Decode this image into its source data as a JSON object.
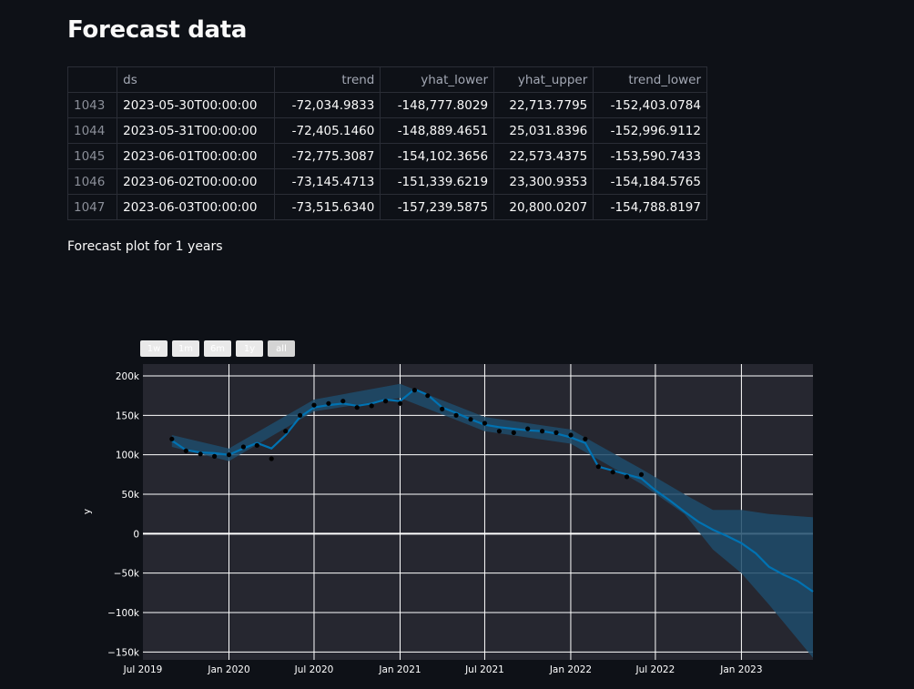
{
  "page": {
    "title": "Forecast data",
    "caption": "Forecast plot for 1 years"
  },
  "table": {
    "columns": [
      "",
      "ds",
      "trend",
      "yhat_lower",
      "yhat_upper",
      "trend_lower"
    ],
    "rows": [
      [
        "1043",
        "2023-05-30T00:00:00",
        "-72,034.9833",
        "-148,777.8029",
        "22,713.7795",
        "-152,403.0784"
      ],
      [
        "1044",
        "2023-05-31T00:00:00",
        "-72,405.1460",
        "-148,889.4651",
        "25,031.8396",
        "-152,996.9112"
      ],
      [
        "1045",
        "2023-06-01T00:00:00",
        "-72,775.3087",
        "-154,102.3656",
        "22,573.4375",
        "-153,590.7433"
      ],
      [
        "1046",
        "2023-06-02T00:00:00",
        "-73,145.4713",
        "-151,339.6219",
        "23,300.9353",
        "-154,184.5765"
      ],
      [
        "1047",
        "2023-06-03T00:00:00",
        "-73,515.6340",
        "-157,239.5875",
        "20,800.0207",
        "-154,788.8197"
      ]
    ]
  },
  "range_selector": [
    {
      "label": "1w",
      "active": false
    },
    {
      "label": "1m",
      "active": false
    },
    {
      "label": "6m",
      "active": false
    },
    {
      "label": "1y",
      "active": false
    },
    {
      "label": "all",
      "active": true
    }
  ],
  "colors": {
    "background": "#0e1117",
    "plot_bg": "#262730",
    "forecast_line": "#0072b2",
    "uncertainty_band": "#1f4c6b",
    "actual_points": "#000000",
    "grid": "#ffffff"
  },
  "chart_data": {
    "type": "line",
    "title": "",
    "xlabel": "",
    "ylabel": "y",
    "x_ticks": [
      "Jul 2019",
      "Jan 2020",
      "Jul 2020",
      "Jan 2021",
      "Jul 2021",
      "Jan 2022",
      "Jul 2022",
      "Jan 2023"
    ],
    "y_ticks": [
      "−150k",
      "−100k",
      "−50k",
      "0",
      "50k",
      "100k",
      "150k",
      "200k"
    ],
    "xlim": [
      "2019-07-01",
      "2023-06-03"
    ],
    "ylim": [
      -160000,
      215000
    ],
    "grid": true,
    "legend": "none",
    "series": [
      {
        "kind": "actual",
        "x": [
          "2019-09-01",
          "2019-10-01",
          "2019-11-01",
          "2019-12-01",
          "2020-01-01",
          "2020-02-01",
          "2020-03-01",
          "2020-04-01",
          "2020-05-01",
          "2020-06-01",
          "2020-07-01",
          "2020-08-01",
          "2020-09-01",
          "2020-10-01",
          "2020-11-01",
          "2020-12-01",
          "2021-01-01",
          "2021-02-01",
          "2021-03-01",
          "2021-04-01",
          "2021-05-01",
          "2021-06-01",
          "2021-07-01",
          "2021-08-01",
          "2021-09-01",
          "2021-10-01",
          "2021-11-01",
          "2021-12-01",
          "2022-01-01",
          "2022-02-01",
          "2022-03-01",
          "2022-04-01",
          "2022-05-01",
          "2022-06-01"
        ],
        "y": [
          120000,
          105000,
          101000,
          98000,
          100000,
          110000,
          112000,
          95000,
          130000,
          150000,
          163000,
          165000,
          168000,
          160000,
          162000,
          168000,
          165000,
          182000,
          175000,
          158000,
          150000,
          145000,
          140000,
          130000,
          128000,
          133000,
          130000,
          128000,
          125000,
          120000,
          85000,
          78000,
          72000,
          75000
        ]
      },
      {
        "kind": "forecast",
        "x": [
          "2019-09-01",
          "2019-10-01",
          "2019-11-01",
          "2019-12-01",
          "2020-01-01",
          "2020-02-01",
          "2020-03-01",
          "2020-04-01",
          "2020-05-01",
          "2020-06-01",
          "2020-07-01",
          "2020-08-01",
          "2020-09-01",
          "2020-10-01",
          "2020-11-01",
          "2020-12-01",
          "2021-01-01",
          "2021-02-01",
          "2021-03-01",
          "2021-04-01",
          "2021-05-01",
          "2021-06-01",
          "2021-07-01",
          "2021-08-01",
          "2021-09-01",
          "2021-10-01",
          "2021-11-01",
          "2021-12-01",
          "2022-01-01",
          "2022-02-01",
          "2022-03-01",
          "2022-04-01",
          "2022-05-01",
          "2022-06-01",
          "2022-07-01",
          "2022-08-01",
          "2022-09-01",
          "2022-10-01",
          "2022-11-01",
          "2022-12-01",
          "2023-01-01",
          "2023-02-01",
          "2023-03-01",
          "2023-04-01",
          "2023-05-01",
          "2023-06-03"
        ],
        "y": [
          118000,
          106000,
          103000,
          102000,
          100000,
          108000,
          115000,
          108000,
          125000,
          148000,
          160000,
          163000,
          165000,
          162000,
          165000,
          170000,
          168000,
          183000,
          176000,
          160000,
          153000,
          145000,
          138000,
          135000,
          133000,
          131000,
          130000,
          127000,
          122000,
          115000,
          85000,
          80000,
          75000,
          70000,
          55000,
          42000,
          28000,
          15000,
          5000,
          -3000,
          -12000,
          -25000,
          -42000,
          -52000,
          -60000,
          -73516
        ]
      },
      {
        "kind": "upper",
        "x": [
          "2019-09-01",
          "2020-01-01",
          "2020-07-01",
          "2021-01-01",
          "2021-07-01",
          "2022-01-01",
          "2022-06-01",
          "2022-09-01",
          "2022-11-01",
          "2023-01-01",
          "2023-03-01",
          "2023-06-03"
        ],
        "y": [
          125000,
          108000,
          170000,
          190000,
          148000,
          132000,
          82000,
          50000,
          30000,
          30000,
          25000,
          20800
        ]
      },
      {
        "kind": "lower",
        "x": [
          "2019-09-01",
          "2020-01-01",
          "2020-07-01",
          "2021-01-01",
          "2021-07-01",
          "2022-01-01",
          "2022-06-01",
          "2022-09-01",
          "2022-11-01",
          "2023-01-01",
          "2023-03-01",
          "2023-06-03"
        ],
        "y": [
          110000,
          92000,
          155000,
          172000,
          130000,
          114000,
          63000,
          25000,
          -20000,
          -50000,
          -90000,
          -157240
        ]
      }
    ]
  }
}
